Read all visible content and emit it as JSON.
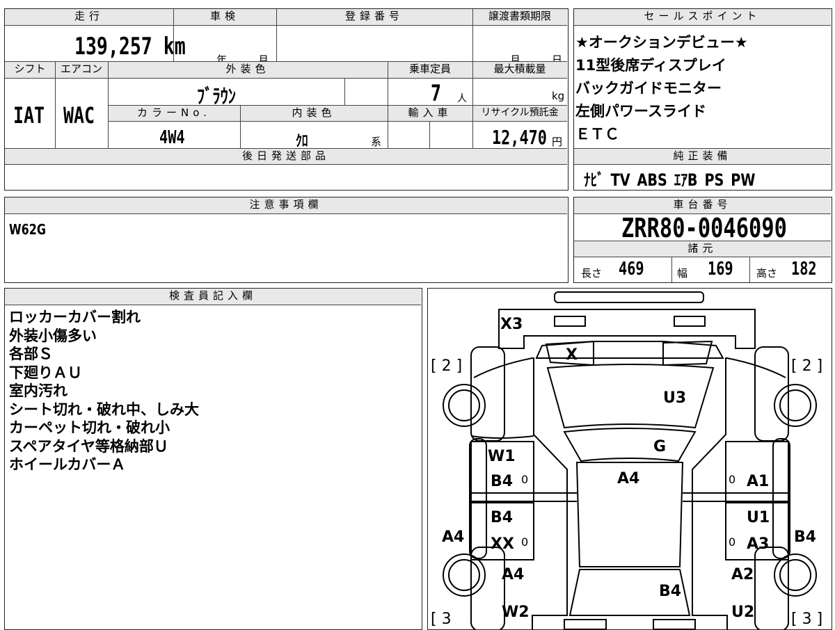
{
  "headers": {
    "mileage": "走行",
    "shaken": "車検",
    "registration": "登録番号",
    "transfer_deadline": "譲渡書類期限",
    "shift": "シフト",
    "aircon": "エアコン",
    "exterior_color": "外装色",
    "capacity": "乗車定員",
    "max_load": "最大積載量",
    "color_no": "カラーNo.",
    "interior_color": "内装色",
    "import": "輸入車",
    "recycle": "リサイクル預託金",
    "later_parts": "後日発送部品",
    "notes": "注意事項欄",
    "sales_points": "セールスポイント",
    "genuine_equipment": "純正装備",
    "chassis_no": "車台番号",
    "specs": "諸元",
    "inspector": "検査員記入欄"
  },
  "vehicle": {
    "mileage": "139,257 km",
    "shaken_year_unit": "年",
    "shaken_month_unit": "月",
    "transfer_month_unit": "月",
    "transfer_day_unit": "日",
    "shift": "IAT",
    "aircon": "WAC",
    "exterior_color": "ﾌﾞﾗｳﾝ",
    "capacity": "7",
    "capacity_unit": "人",
    "max_load_unit": "kg",
    "color_no": "4W4",
    "interior_color": "ｸﾛ",
    "interior_suffix": "系",
    "recycle_fee": "12,470",
    "recycle_unit": "円",
    "note": "W62G",
    "chassis_no": "ZRR80-0046090",
    "length_label": "長さ",
    "length": "469",
    "width_label": "幅",
    "width": "169",
    "height_label": "高さ",
    "height": "182"
  },
  "sales_points": [
    "★オークションデビュー★",
    "11型後席ディスプレイ",
    "バックガイドモニター",
    "左側パワースライド",
    "ＥＴＣ"
  ],
  "equipment": "ﾅﾋﾞ TV ABS ｴｱB PS PW",
  "inspector_remarks": [
    "ロッカーカバー割れ",
    "外装小傷多い",
    "各部Ｓ",
    "下廻りＡＵ",
    "室内汚れ",
    "シート切れ・破れ中、しみ大",
    "カーペット切れ・破れ小",
    "スペアタイヤ等格納部Ｕ",
    "ホイールカバーＡ"
  ],
  "diagram": {
    "tire_tl": "[ 2 ]",
    "tire_tr": "[ 2 ]",
    "tire_bl": "[ 3",
    "tire_br": "[ 3 ]",
    "bumper_front": "X3",
    "grille": "X",
    "hood": "U3",
    "windshield": "G",
    "roof": "A4",
    "front_door_left_a": "W1",
    "front_door_left_b": "B4",
    "rear_door_left_a": "B4",
    "rear_door_left_b": "XX",
    "front_door_right": "A1",
    "rear_door_right_a": "U1",
    "rear_door_right_b": "A3",
    "rocker_left": "A4",
    "rocker_right": "B4",
    "rear_fender_left_a": "A4",
    "rear_fender_left_b": "W2",
    "rear_fender_right_a": "A2",
    "rear_fender_right_b": "U2",
    "back_window": "B4",
    "zero_1": "0",
    "zero_2": "0",
    "zero_3": "0",
    "zero_4": "0"
  }
}
